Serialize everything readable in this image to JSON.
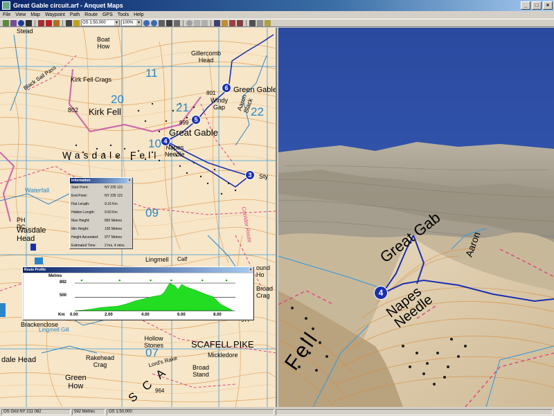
{
  "window": {
    "title": "Great Gable circuit.arf - Anquet Maps",
    "minimize": "_",
    "maximize": "□",
    "close": "×"
  },
  "menu": [
    "File",
    "View",
    "Map",
    "Waypoint",
    "Path",
    "Route",
    "GPS",
    "Tools",
    "Help"
  ],
  "toolbar": {
    "map_scale": "OS 1:50,000",
    "zoom": "100%"
  },
  "map": {
    "labels": {
      "stead": "Stead",
      "boat_how": "Boat\nHow",
      "gillercomb_head": "Gillercomb\nHead",
      "kirk_fell_crags": "Kirk Fell  Crags",
      "black_sail_pass": "Black Sail Pass",
      "kirk_fell": "Kirk Fell",
      "h802": "802",
      "h801": "801",
      "h899": "899",
      "green_gable": "Green Gable",
      "windy_gap": "Windy\nGap",
      "great_gable": "Great Gable",
      "aaron_slack": "Aaron\nSlack",
      "napes_needle": "Napes\nNeedle",
      "wasdale_fell": "Wasdale Fell",
      "sty": "Sty",
      "waterfall": "Waterfall",
      "wasdale_head": "Wasdale\nHead",
      "ph": "PH",
      "pc": "PC",
      "lingmell": "Lingmell",
      "round_how": "ound\nHo",
      "broad_crag": "Broad\nCrag",
      "brackenclose": "Brackenclose",
      "hollow_stones": "Hollow\nStones",
      "scafell_pike": "SCAFELL PIKE",
      "mickledore": "Mickledore",
      "rakehead_crag": "Rakehead\nCrag",
      "lords_rake": "Lord's Rake",
      "broad_stand": "Broad\nStand",
      "h964": "964",
      "h977": "977",
      "wasdale_head_bottom": "dale Head",
      "green_how": "Green\nHow",
      "sca": "S C A",
      "calf": "Calf",
      "lingmell_gill": "Lingmell Gill",
      "corridor_route": "Corridor Route"
    },
    "grid_numbers": {
      "g20": "20",
      "g21": "21",
      "g22": "22",
      "g11": "11",
      "g10": "10",
      "g09": "09",
      "g07": "07"
    },
    "waypoints": [
      "6",
      "5",
      "4",
      "3"
    ]
  },
  "information": {
    "title": "Information",
    "rows": [
      {
        "key": "Start Point:",
        "value": "NY 235 121"
      },
      {
        "key": "End Point:",
        "value": "NY 235 121"
      },
      {
        "key": "Flat Length:",
        "value": "9.16 Km"
      },
      {
        "key": "Hidden Length:",
        "value": "9.50 Km"
      },
      {
        "key": "Max Height:",
        "value": "892 Metres"
      },
      {
        "key": "Min Height:",
        "value": "130 Metres"
      },
      {
        "key": "Height Ascended:",
        "value": "977 Metres"
      },
      {
        "key": "Estimated Time:",
        "value": "2 hrs, 4 mins"
      }
    ]
  },
  "profile": {
    "title": "Route Profile",
    "y_unit": "Metres",
    "x_unit": "Km",
    "y_ticks": [
      "892",
      "500"
    ],
    "x_ticks": [
      "0.00",
      "2.00",
      "4.00",
      "6.00",
      "8.00"
    ]
  },
  "chart_data": {
    "type": "area",
    "title": "Route Profile",
    "xlabel": "Km",
    "ylabel": "Metres",
    "xlim": [
      0,
      9.16
    ],
    "ylim": [
      130,
      892
    ],
    "x": [
      0,
      0.5,
      1,
      1.5,
      2,
      2.5,
      3,
      3.5,
      4,
      4.5,
      5,
      5.2,
      5.5,
      5.8,
      6,
      6.2,
      6.5,
      7,
      7.5,
      8,
      8.5,
      9.16
    ],
    "y": [
      130,
      150,
      180,
      220,
      240,
      260,
      320,
      400,
      460,
      520,
      560,
      650,
      892,
      820,
      720,
      860,
      780,
      700,
      600,
      520,
      300,
      140
    ]
  },
  "view3d": {
    "labels": {
      "great_gable": "Great Gab",
      "napes_needle": "Napes\nNeedle",
      "fell": "Fell",
      "aaron": "Aaron"
    },
    "waypoint": "4"
  },
  "status": {
    "grid_ref": "OS Grid NY 211 082",
    "height": "592 Metres",
    "scale": "OS 1:50,000"
  },
  "colors": {
    "contour": "#d98a3a",
    "grid": "#3a9ad9",
    "route": "#1a2fb0",
    "boundary": "#c85fa8",
    "profile_fill": "#22dd22",
    "sky": "#2e4fa0"
  }
}
